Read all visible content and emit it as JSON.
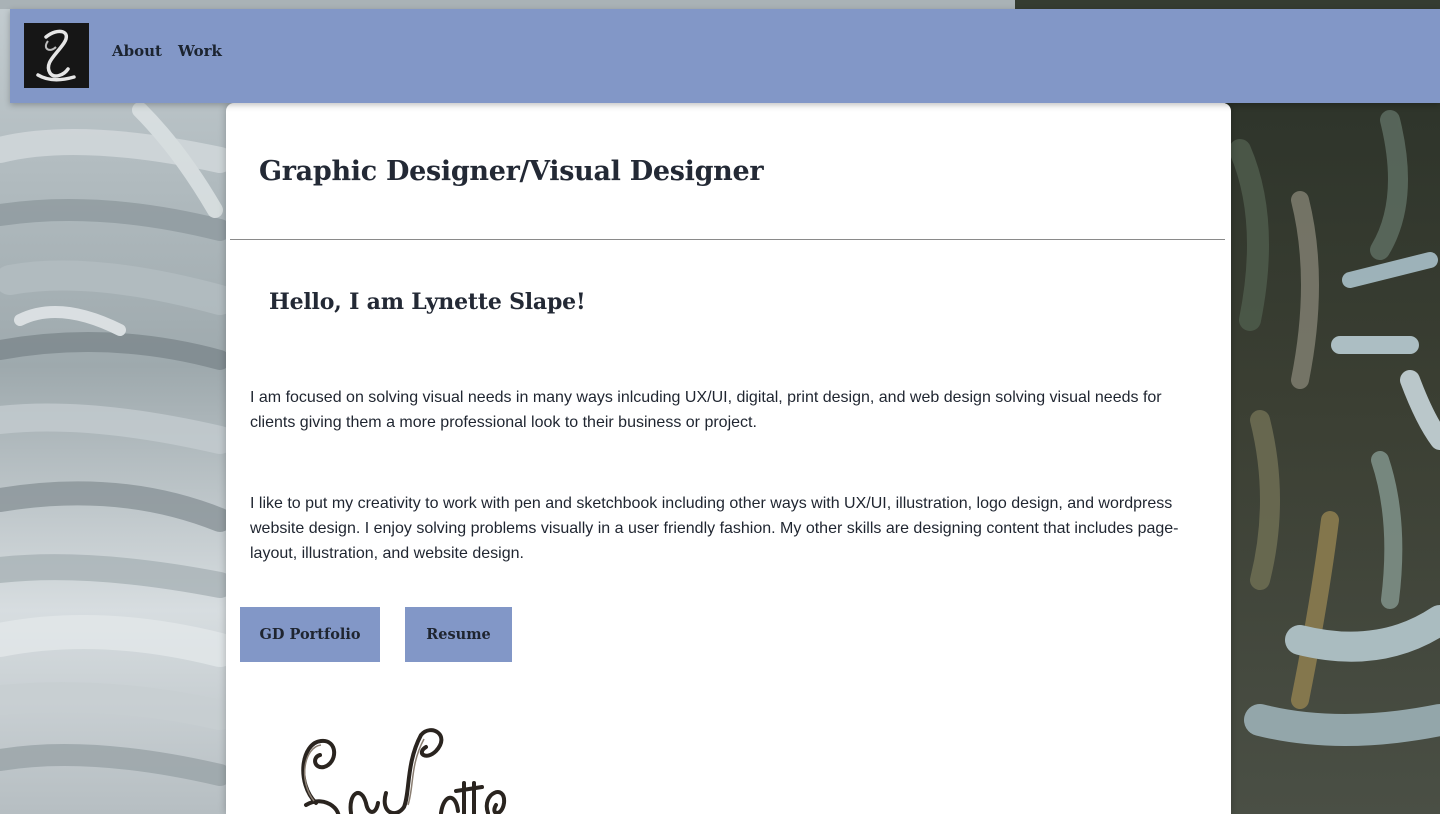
{
  "nav": {
    "items": [
      {
        "label": "About"
      },
      {
        "label": "Work"
      }
    ]
  },
  "main": {
    "title": "Graphic Designer/Visual Designer",
    "greeting": "Hello, I am Lynette Slape!",
    "paragraphs": [
      "I am focused on solving visual needs in many ways inlcuding UX/UI, digital, print design, and web design solving visual needs for clients giving them a more professional look to their business or project.",
      "I like to put my creativity to work with pen and sketchbook including other ways with UX/UI, illustration, logo design, and wordpress website design. I enjoy solving problems visually in a user friendly fashion. My other skills are designing content that includes page-layout, illustration, and website design."
    ],
    "buttons": [
      {
        "label": "GD Portfolio"
      },
      {
        "label": "Resume"
      }
    ],
    "signature_text": "Lynette"
  },
  "colors": {
    "nav_bg": "#8297c7",
    "button_bg": "#8297c7",
    "text_dark": "#232935",
    "card_bg": "#ffffff"
  },
  "icons": {
    "logo": "script-l-logo",
    "signature": "lynette-signature-image",
    "background": "painted-brushstroke-background"
  }
}
